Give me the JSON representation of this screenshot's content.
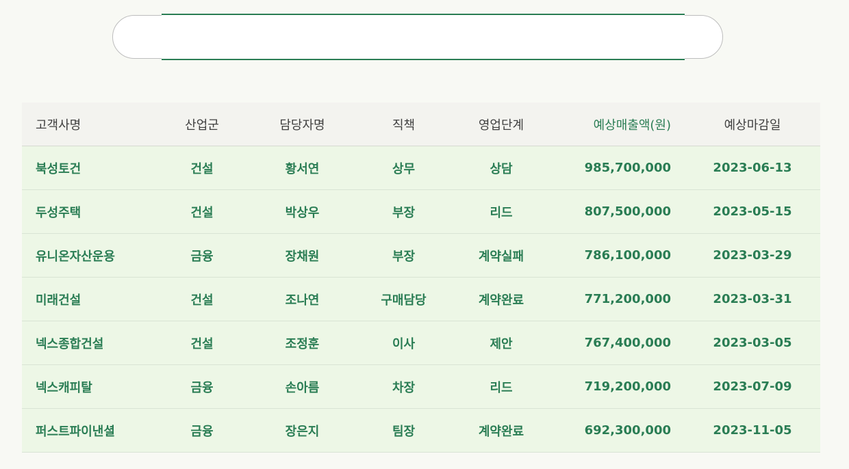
{
  "search": {
    "value": "",
    "placeholder": ""
  },
  "table": {
    "columns": [
      "고객사명",
      "산업군",
      "담당자명",
      "직책",
      "영업단계",
      "예상매출액(원)",
      "예상마감일"
    ],
    "sorted_column": "예상매출액(원)",
    "rows": [
      [
        "북성토건",
        "건설",
        "황서연",
        "상무",
        "상담",
        "985,700,000",
        "2023-06-13"
      ],
      [
        "두성주택",
        "건설",
        "박상우",
        "부장",
        "리드",
        "807,500,000",
        "2023-05-15"
      ],
      [
        "유니온자산운용",
        "금융",
        "장채원",
        "부장",
        "계약실패",
        "786,100,000",
        "2023-03-29"
      ],
      [
        "미래건설",
        "건설",
        "조나연",
        "구매담당",
        "계약완료",
        "771,200,000",
        "2023-03-31"
      ],
      [
        "넥스종합건설",
        "건설",
        "조정훈",
        "이사",
        "제안",
        "767,400,000",
        "2023-03-05"
      ],
      [
        "넥스캐피탈",
        "금융",
        "손아름",
        "차장",
        "리드",
        "719,200,000",
        "2023-07-09"
      ],
      [
        "퍼스트파이낸셜",
        "금융",
        "장은지",
        "팀장",
        "계약완료",
        "692,300,000",
        "2023-11-05"
      ]
    ]
  },
  "colors": {
    "accent": "#2a7d54",
    "row_background": "#edf7e6",
    "header_background": "#f3f3ef",
    "page_background": "#f8f9f4"
  }
}
